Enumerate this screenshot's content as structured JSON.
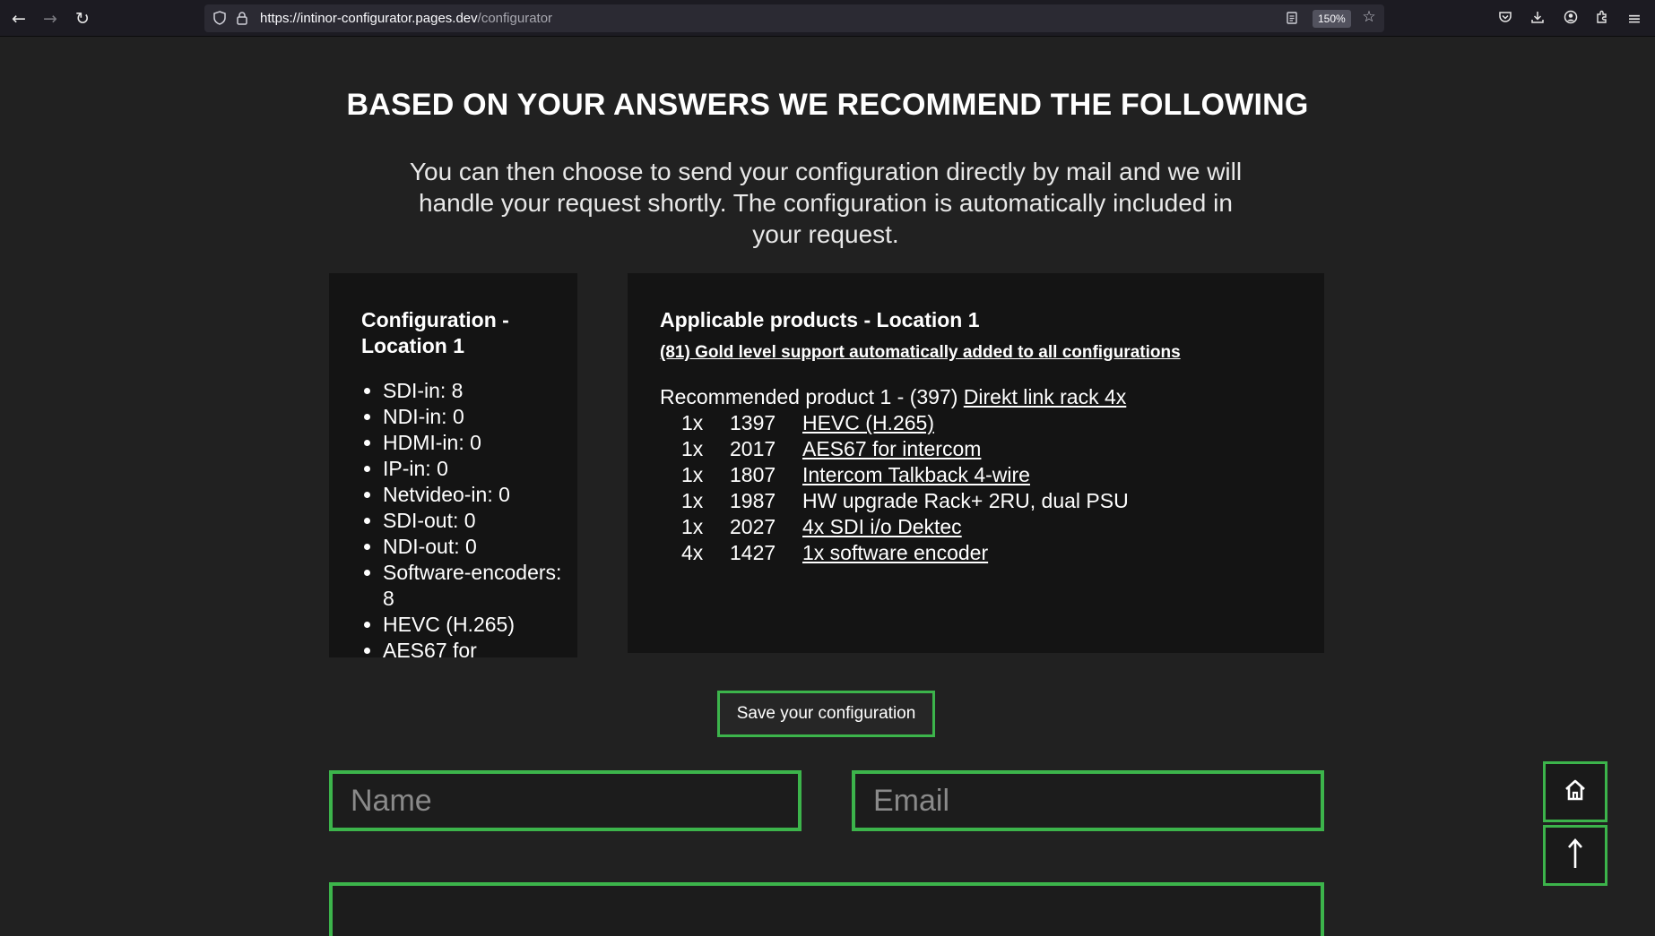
{
  "browser": {
    "url_host": "https://intinor-configurator.pages.dev",
    "url_path": "/configurator",
    "zoom": "150%"
  },
  "page": {
    "title": "BASED ON YOUR ANSWERS WE RECOMMEND THE FOLLOWING",
    "intro": "You can then choose to send your configuration directly by mail and we will handle your request shortly. The configuration is automatically included in your request."
  },
  "config": {
    "heading": "Configuration - Location 1",
    "items": [
      "SDI-in: 8",
      "NDI-in: 0",
      "HDMI-in: 0",
      "IP-in: 0",
      "Netvideo-in: 0",
      "SDI-out: 0",
      "NDI-out: 0",
      "Software-encoders: 8",
      "HEVC (H.265)",
      "AES67 for"
    ]
  },
  "products": {
    "heading": "Applicable products - Location 1",
    "support_link": "(81) Gold level support automatically added to all configurations",
    "recommended_prefix": "Recommended product 1 - (397) ",
    "recommended_link": "Direkt link rack 4x",
    "rows": [
      {
        "qty": "1x",
        "code": "1397",
        "name": "HEVC (H.265)",
        "link": true
      },
      {
        "qty": "1x",
        "code": "2017",
        "name": "AES67 for intercom",
        "link": true
      },
      {
        "qty": "1x",
        "code": "1807",
        "name": "Intercom Talkback 4-wire",
        "link": true
      },
      {
        "qty": "1x",
        "code": "1987",
        "name": "HW upgrade Rack+ 2RU, dual PSU",
        "link": false
      },
      {
        "qty": "1x",
        "code": "2027",
        "name": "4x SDI i/o Dektec",
        "link": true
      },
      {
        "qty": "4x",
        "code": "1427",
        "name": "1x software encoder",
        "link": true
      }
    ]
  },
  "form": {
    "save_label": "Save your configuration",
    "name_placeholder": "Name",
    "email_placeholder": "Email"
  },
  "colors": {
    "accent": "#3cb44b",
    "background": "#212121",
    "panel": "#141414"
  },
  "icons": {
    "home": "home-icon",
    "top": "arrow-up-icon"
  }
}
